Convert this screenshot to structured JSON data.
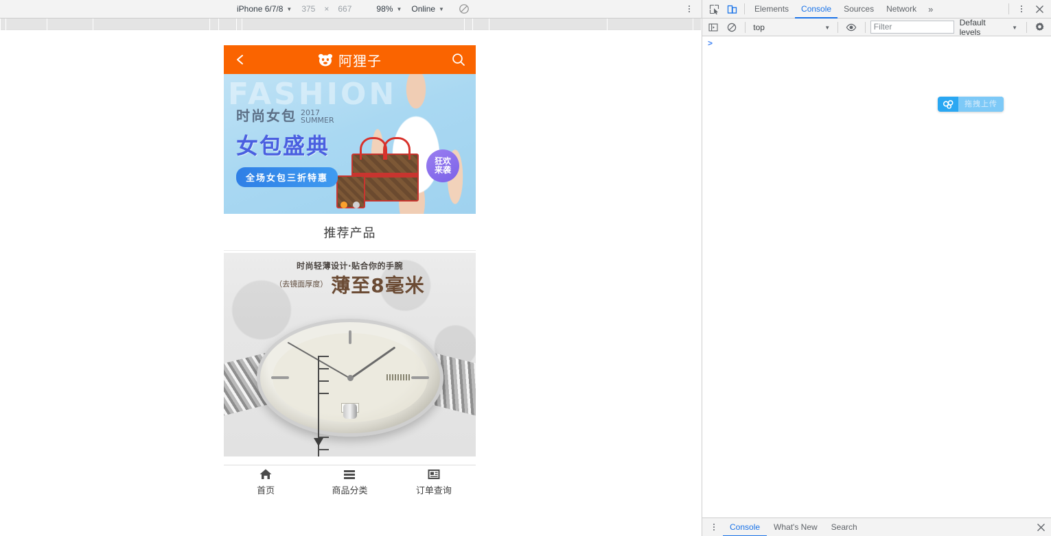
{
  "device_toolbar": {
    "device": "iPhone 6/7/8",
    "width": "375",
    "x_sep": "×",
    "height": "667",
    "zoom": "98%",
    "throttling": "Online",
    "rotate_icon": "rotate-icon",
    "menu_icon": "more-vertical-icon"
  },
  "mobile_page": {
    "header": {
      "back_icon": "chevron-left-icon",
      "logo_icon": "mascot-face-icon",
      "title": "阿狸子",
      "search_icon": "search-icon",
      "bg_color": "#fa6400"
    },
    "banner": {
      "ghost_text": "FASHION",
      "line1_main": "时尚女包",
      "line1_year": "2017",
      "line1_season": "SUMMER",
      "line2": "女包盛典",
      "pill": "全场女包三折特惠",
      "badge_line1": "狂欢",
      "badge_line2": "来袭",
      "dots": [
        {
          "active": true
        },
        {
          "active": false
        }
      ],
      "accent_color": "#4a5fe0",
      "pill_color": "#2f7fe6",
      "badge_color": "#7b62e8",
      "dot_active_color": "#fba12c"
    },
    "section_title": "推荐产品",
    "watch_promo": {
      "tagline": "时尚轻薄设计·贴合你的手腕",
      "note": "（去镜面厚度）",
      "headline": "薄至8毫米"
    },
    "tabbar": [
      {
        "icon": "home-icon",
        "label": "首页"
      },
      {
        "icon": "list-icon",
        "label": "商品分类"
      },
      {
        "icon": "order-icon",
        "label": "订单查询"
      }
    ]
  },
  "devtools": {
    "inspect_icon": "inspect-cursor-icon",
    "device_toggle_icon": "device-toolbar-icon",
    "tabs": [
      {
        "label": "Elements",
        "active": false
      },
      {
        "label": "Console",
        "active": true
      },
      {
        "label": "Sources",
        "active": false
      },
      {
        "label": "Network",
        "active": false
      }
    ],
    "more_tabs": "»",
    "menu_icon": "more-vertical-icon",
    "close_icon": "close-icon",
    "console_toolbar": {
      "sidebar_icon": "console-sidebar-icon",
      "clear_icon": "clear-console-icon",
      "context": "top",
      "eye_icon": "live-expression-icon",
      "filter_placeholder": "Filter",
      "levels": "Default levels",
      "settings_icon": "gear-icon"
    },
    "prompt": ">",
    "float_widget": {
      "icon": "cloud-upload-icon",
      "label": "拖拽上传",
      "color": "#2aa7f2"
    },
    "drawer_tabs": [
      {
        "label": "Console",
        "active": true
      },
      {
        "label": "What's New",
        "active": false
      },
      {
        "label": "Search",
        "active": false
      }
    ],
    "drawer_menu_icon": "more-vertical-icon",
    "drawer_close_icon": "close-icon"
  }
}
